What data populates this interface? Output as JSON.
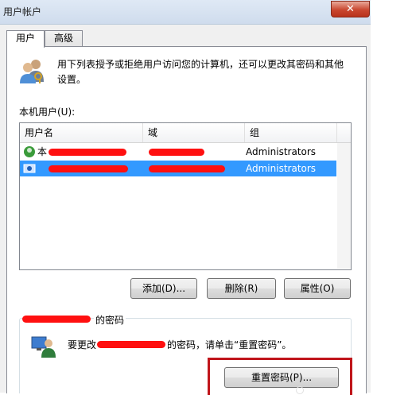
{
  "window": {
    "title": "用户帐户",
    "close_symbol": "✕"
  },
  "tabs": [
    {
      "label": "用户",
      "active": true
    },
    {
      "label": "高级",
      "active": false
    }
  ],
  "description": "用下列表授予或拒绝用户访问您的计算机，还可以更改其密码和其他设置。",
  "user_list": {
    "label": "本机用户(U):",
    "columns": [
      "用户名",
      "域",
      "组"
    ],
    "rows": [
      {
        "name": "本",
        "group": "Administrators",
        "selected": false
      },
      {
        "name": "",
        "group": "Administrators",
        "selected": true
      }
    ]
  },
  "buttons": {
    "add": "添加(D)...",
    "remove": "删除(R)",
    "properties": "属性(O)",
    "reset_password": "重置密码(P)..."
  },
  "password_section": {
    "title_suffix": "的密码",
    "text_prefix": "要更改",
    "text_suffix": "的密码，请单击“重置密码”。"
  },
  "colors": {
    "selection": "#3399ff",
    "redaction": "#ff1010",
    "highlight_border": "#c0151b"
  }
}
